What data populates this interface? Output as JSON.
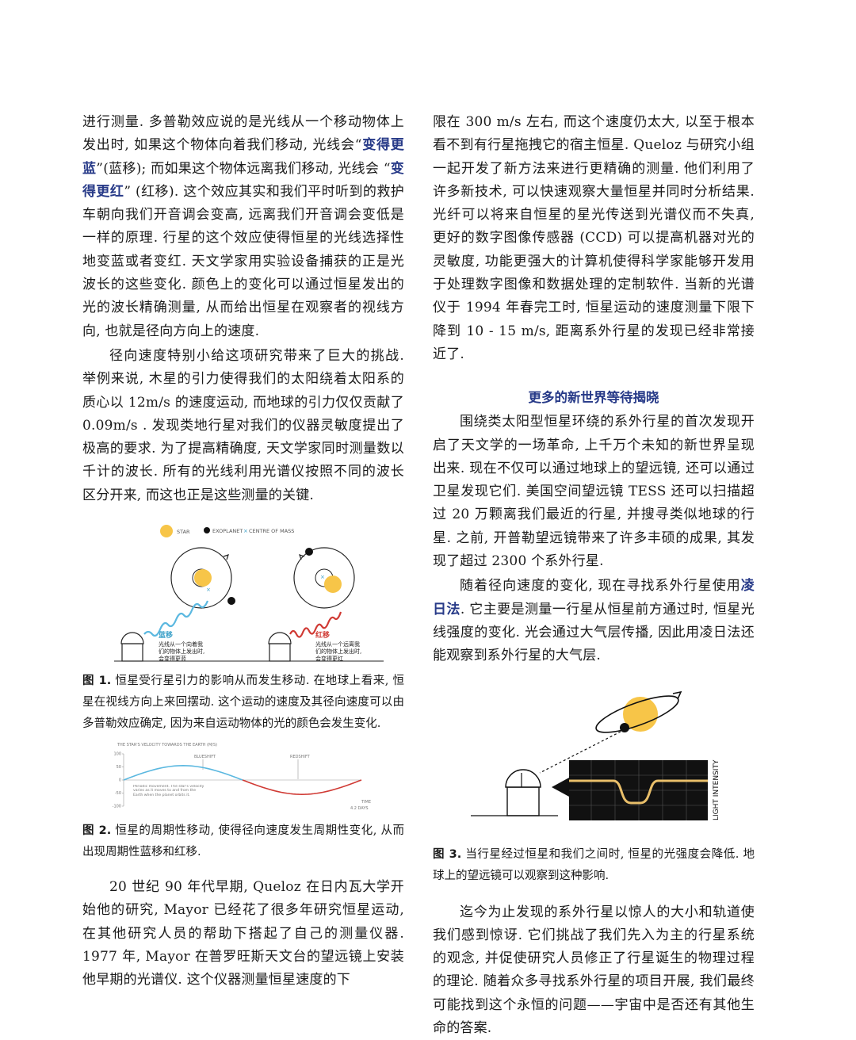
{
  "left": {
    "p1_a": "进行测量. 多普勒效应说的是光线从一个移动物体上发出时, 如果这个物体向着我们移动, 光线会“",
    "p1_em1": "变得更蓝",
    "p1_b": "”(蓝移); 而如果这个物体远离我们移动, 光线会 “",
    "p1_em2": "变得更红",
    "p1_c": "” (红移). 这个效应其实和我们平时听到的救护车朝向我们开音调会变高, 远离我们开音调会变低是一样的原理. 行星的这个效应使得恒星的光线选择性地变蓝或者变红. 天文学家用实验设备捕获的正是光波长的这些变化. 颜色上的变化可以通过恒星发出的光的波长精确测量, 从而给出恒星在观察者的视线方向, 也就是径向方向上的速度.",
    "p2": "径向速度特别小给这项研究带来了巨大的挑战. 举例来说, 木星的引力使得我们的太阳绕着太阳系的质心以 12m/s 的速度运动, 而地球的引力仅仅贡献了 0.09m/s . 发现类地行星对我们的仪器灵敏度提出了极高的要求. 为了提高精确度, 天文学家同时测量数以千计的波长. 所有的光线利用光谱仪按照不同的波长区分开来, 而这也正是这些测量的关键.",
    "fig1": {
      "legend_star": "STAR",
      "legend_exoplanet": "EXOPLANET",
      "legend_com": "CENTRE OF MASS",
      "blue_title": "蓝移",
      "blue_line1": "光线从一个向着我",
      "blue_line2": "们的物体上发出时,",
      "blue_line3": "会变得更蓝",
      "red_title": "红移",
      "red_line1": "光线从一个远离我",
      "red_line2": "们的物体上发出时,",
      "red_line3": "会变得更红",
      "caption_label": "图 1.",
      "caption_text": " 恒星受行星引力的影响从而发生移动. 在地球上看来, 恒星在视线方向上来回摆动. 这个运动的速度及其径向速度可以由多普勒效应确定, 因为来自运动物体的光的颜色会发生变化."
    },
    "fig2": {
      "caption_label": "图 2.",
      "caption_text": " 恒星的周期性移动, 使得径向速度发生周期性变化, 从而出现周期性蓝移和红移."
    },
    "p3": "20 世纪 90 年代早期, Queloz 在日内瓦大学开始他的研究, Mayor 已经花了很多年研究恒星运动, 在其他研究人员的帮助下搭起了自己的测量仪器. 1977 年, Mayor 在普罗旺斯天文台的望远镜上安装他早期的光谱仪. 这个仪器测量恒星速度的下"
  },
  "right": {
    "p1": "限在 300 m/s 左右, 而这个速度仍太大, 以至于根本看不到有行星拖拽它的宿主恒星. Queloz 与研究小组一起开发了新方法来进行更精确的测量. 他们利用了许多新技术, 可以快速观察大量恒星并同时分析结果. 光纤可以将来自恒星的星光传送到光谱仪而不失真, 更好的数字图像传感器 (CCD) 可以提高机器对光的灵敏度, 功能更强大的计算机使得科学家能够开发用于处理数字图像和数据处理的定制软件. 当新的光谱仪于 1994 年春完工时, 恒星运动的速度测量下限下降到 10 - 15 m/s, 距离系外行星的发现已经非常接近了.",
    "section_title": "更多的新世界等待揭晓",
    "p2": "围绕类太阳型恒星环绕的系外行星的首次发现开启了天文学的一场革命, 上千万个未知的新世界呈现出来. 现在不仅可以通过地球上的望远镜, 还可以通过卫星发现它们. 美国空间望远镜 TESS 还可以扫描超过 20 万颗离我们最近的行星, 并搜寻类似地球的行星. 之前, 开普勒望远镜带来了许多丰硕的成果, 其发现了超过 2300 个系外行星.",
    "p3_a": "随着径向速度的变化, 现在寻找系外行星使用",
    "p3_em": "凌日法",
    "p3_b": ". 它主要是测量一行星从恒星前方通过时, 恒星光线强度的变化. 光会通过大气层传播, 因此用凌日法还能观察到系外行星的大气层.",
    "fig3": {
      "axis_label": "LIGHT INTENSITY",
      "caption_label": "图 3.",
      "caption_text": " 当行星经过恒星和我们之间时, 恒星的光强度会降低. 地球上的望远镜可以观察到这种影响."
    },
    "p4": "迄今为止发现的系外行星以惊人的大小和轨道使我们感到惊讶. 它们挑战了我们先入为主的行星系统的观念, 并促使研究人员修正了行星诞生的物理过程的理论. 随着众多寻找系外行星的项目开展, 我们最终可能找到这个永恒的问题——宇宙中是否还有其他生命的答案."
  },
  "chart_data": {
    "type": "line",
    "title": "THE STAR'S VELOCITY TOWARDS THE EARTH (M/S)",
    "xlabel": "TIME",
    "x_end_label": "4.2 DAYS",
    "yticks": [
      "100",
      "50",
      "0",
      "-50",
      "-100"
    ],
    "ylim": [
      -100,
      100
    ],
    "annotations": [
      "BLUESHIFT",
      "REDSHIFT",
      "Periodic movement. The star's velocity varies as it moves to and from the Earth when the planet orbits it."
    ],
    "series": [
      {
        "segment": "blueshift",
        "color": "#5bb8e0",
        "x": [
          0,
          1.05,
          2.1
        ],
        "y": [
          0,
          55,
          0
        ]
      },
      {
        "segment": "redshift",
        "color": "#d03a34",
        "x": [
          2.1,
          3.15,
          4.2
        ],
        "y": [
          0,
          -55,
          0
        ]
      }
    ]
  },
  "colors": {
    "accent": "#273a88",
    "star": "#f7c548",
    "blue": "#5bb8e0",
    "red": "#d03a34"
  }
}
